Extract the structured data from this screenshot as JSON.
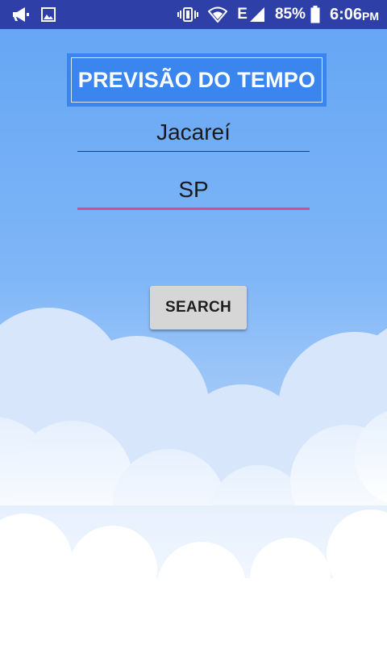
{
  "status_bar": {
    "left_icons": [
      "megaphone-icon",
      "image-icon"
    ],
    "right_icons": [
      "vibrate-icon",
      "wifi-icon",
      "network-e-icon",
      "signal-icon",
      "battery-icon"
    ],
    "network_type": "E",
    "battery_percent": "85%",
    "battery_level": 0.85,
    "time": "6:06",
    "ampm": "PM"
  },
  "app": {
    "title": "PREVISÃO DO TEMPO",
    "city_input": {
      "value": "Jacareí"
    },
    "state_input": {
      "value": "SP"
    },
    "search_button_label": "SEARCH"
  },
  "colors": {
    "status_bar": "#2f3fa8",
    "sky_top": "#66a6f4",
    "title_box": "#3a86ee",
    "focused_underline": "#e3468f",
    "button": "#d6d6d6"
  }
}
